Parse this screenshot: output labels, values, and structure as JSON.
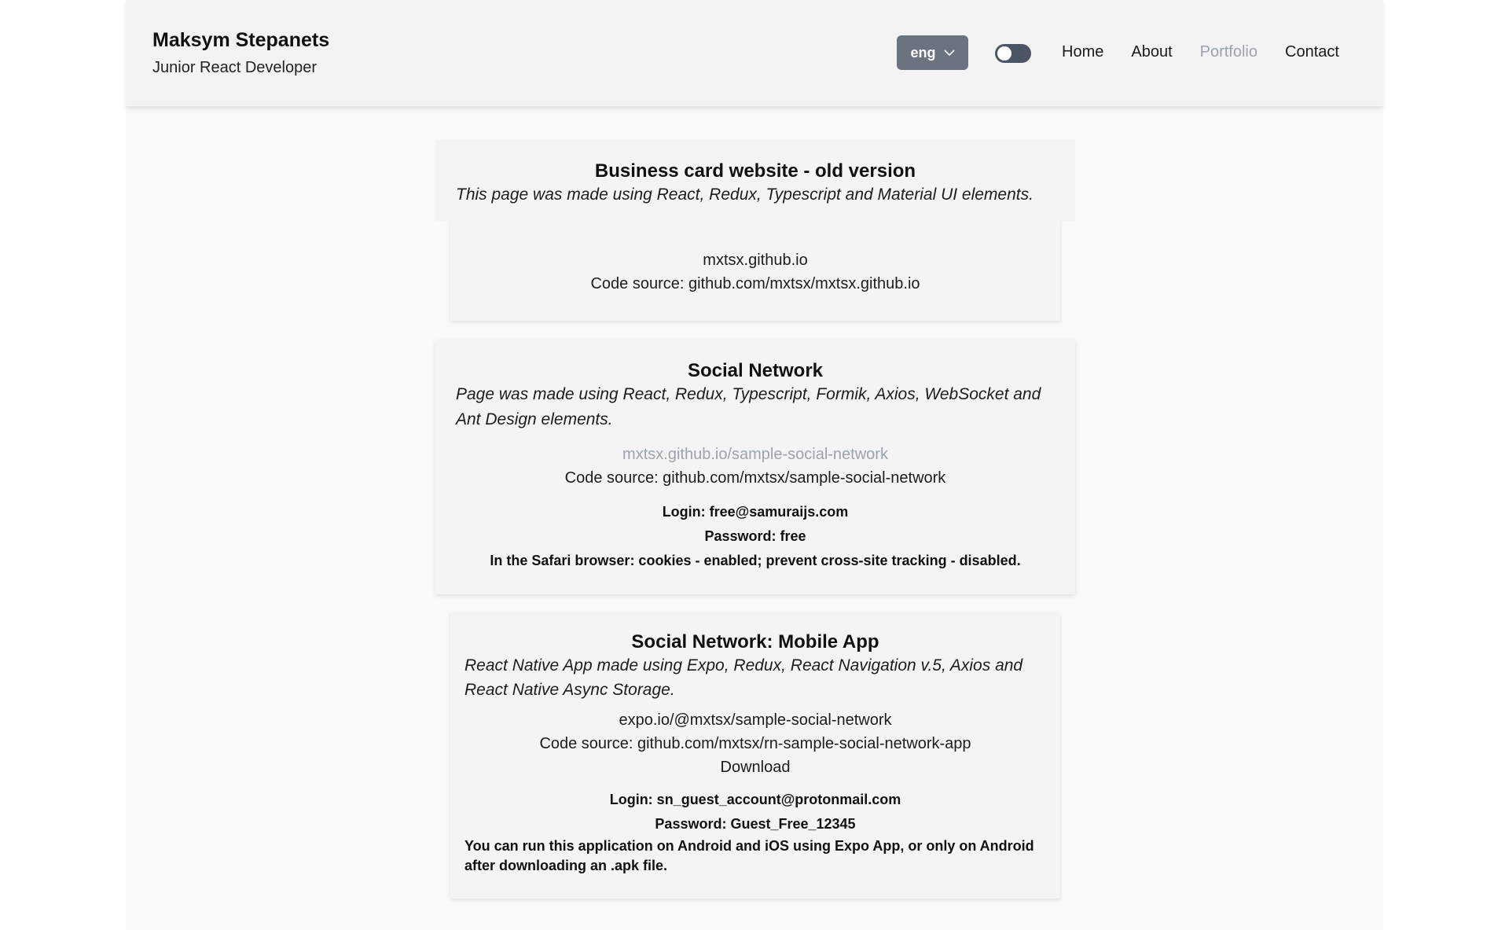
{
  "header": {
    "name": "Maksym Stepanets",
    "role": "Junior React Developer",
    "language": "eng",
    "nav": [
      "Home",
      "About",
      "Portfolio",
      "Contact"
    ],
    "active_nav": "Portfolio"
  },
  "projects": [
    {
      "title": "Business card website - old version",
      "description": "This page was made using React, Redux, Typescript and Material UI elements.",
      "links": [
        "mxtsx.github.io",
        "Code source: github.com/mxtsx/mxtsx.github.io"
      ]
    },
    {
      "title": "Social Network",
      "description": "Page was made using React, Redux, Typescript, Formik, Axios, WebSocket and Ant Design elements.",
      "links": [
        "mxtsx.github.io/sample-social-network",
        "Code source: github.com/mxtsx/sample-social-network"
      ],
      "notes": [
        "Login: free@samuraijs.com",
        "Password: free",
        "In the Safari browser: cookies - enabled; prevent cross-site tracking - disabled."
      ]
    },
    {
      "title": "Social Network: Mobile App",
      "description": "React Native App made using Expo, Redux, React Navigation v.5, Axios and React Native Async Storage.",
      "links": [
        "expo.io/@mxtsx/sample-social-network",
        "Code source: github.com/mxtsx/rn-sample-social-network-app",
        "Download"
      ],
      "notes": [
        "Login: sn_guest_account@protonmail.com",
        "Password: Guest_Free_12345",
        "You can run this application on Android and iOS using Expo App, or only on Android after downloading an .apk file."
      ]
    }
  ],
  "colors": {
    "accent_button": "#6b7280",
    "muted_link": "#9ca3af",
    "card_bg": "#f4f4f4"
  },
  "icons": {
    "language_dropdown": "chevron-down-icon",
    "theme_toggle": "toggle-switch"
  }
}
